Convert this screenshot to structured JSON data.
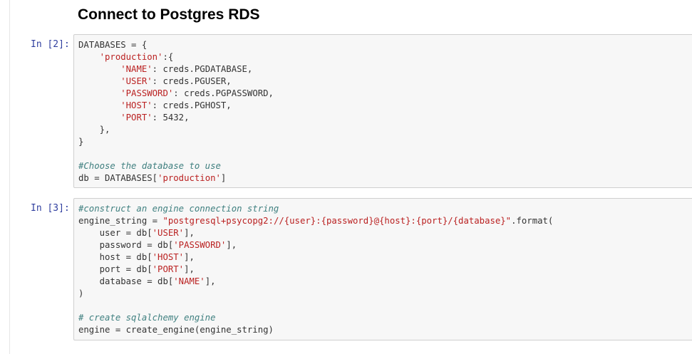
{
  "heading": "Connect to Postgres RDS",
  "cells": [
    {
      "prompt": "In [2]:",
      "lines": [
        [
          {
            "t": "DATABASES = {",
            "k": "p"
          }
        ],
        [
          {
            "t": "    ",
            "k": "p"
          },
          {
            "t": "'production'",
            "k": "s"
          },
          {
            "t": ":{",
            "k": "p"
          }
        ],
        [
          {
            "t": "        ",
            "k": "p"
          },
          {
            "t": "'NAME'",
            "k": "s"
          },
          {
            "t": ": creds.PGDATABASE,",
            "k": "p"
          }
        ],
        [
          {
            "t": "        ",
            "k": "p"
          },
          {
            "t": "'USER'",
            "k": "s"
          },
          {
            "t": ": creds.PGUSER,",
            "k": "p"
          }
        ],
        [
          {
            "t": "        ",
            "k": "p"
          },
          {
            "t": "'PASSWORD'",
            "k": "s"
          },
          {
            "t": ": creds.PGPASSWORD,",
            "k": "p"
          }
        ],
        [
          {
            "t": "        ",
            "k": "p"
          },
          {
            "t": "'HOST'",
            "k": "s"
          },
          {
            "t": ": creds.PGHOST,",
            "k": "p"
          }
        ],
        [
          {
            "t": "        ",
            "k": "p"
          },
          {
            "t": "'PORT'",
            "k": "s"
          },
          {
            "t": ": 5432,",
            "k": "p"
          }
        ],
        [
          {
            "t": "    },",
            "k": "p"
          }
        ],
        [
          {
            "t": "}",
            "k": "p"
          }
        ],
        [],
        [
          {
            "t": "#Choose the database to use",
            "k": "c"
          }
        ],
        [
          {
            "t": "db = DATABASES[",
            "k": "p"
          },
          {
            "t": "'production'",
            "k": "s"
          },
          {
            "t": "]",
            "k": "p"
          }
        ]
      ]
    },
    {
      "prompt": "In [3]:",
      "lines": [
        [
          {
            "t": "#construct an engine connection string",
            "k": "c"
          }
        ],
        [
          {
            "t": "engine_string = ",
            "k": "p"
          },
          {
            "t": "\"postgresql+psycopg2://{user}:{password}@{host}:{port}/{database}\"",
            "k": "s"
          },
          {
            "t": ".format(",
            "k": "p"
          }
        ],
        [
          {
            "t": "    user = db[",
            "k": "p"
          },
          {
            "t": "'USER'",
            "k": "s"
          },
          {
            "t": "],",
            "k": "p"
          }
        ],
        [
          {
            "t": "    password = db[",
            "k": "p"
          },
          {
            "t": "'PASSWORD'",
            "k": "s"
          },
          {
            "t": "],",
            "k": "p"
          }
        ],
        [
          {
            "t": "    host = db[",
            "k": "p"
          },
          {
            "t": "'HOST'",
            "k": "s"
          },
          {
            "t": "],",
            "k": "p"
          }
        ],
        [
          {
            "t": "    port = db[",
            "k": "p"
          },
          {
            "t": "'PORT'",
            "k": "s"
          },
          {
            "t": "],",
            "k": "p"
          }
        ],
        [
          {
            "t": "    database = db[",
            "k": "p"
          },
          {
            "t": "'NAME'",
            "k": "s"
          },
          {
            "t": "],",
            "k": "p"
          }
        ],
        [
          {
            "t": ")",
            "k": "p"
          }
        ],
        [],
        [
          {
            "t": "# create sqlalchemy engine",
            "k": "c"
          }
        ],
        [
          {
            "t": "engine = create_engine(engine_string)",
            "k": "p"
          }
        ]
      ]
    }
  ]
}
